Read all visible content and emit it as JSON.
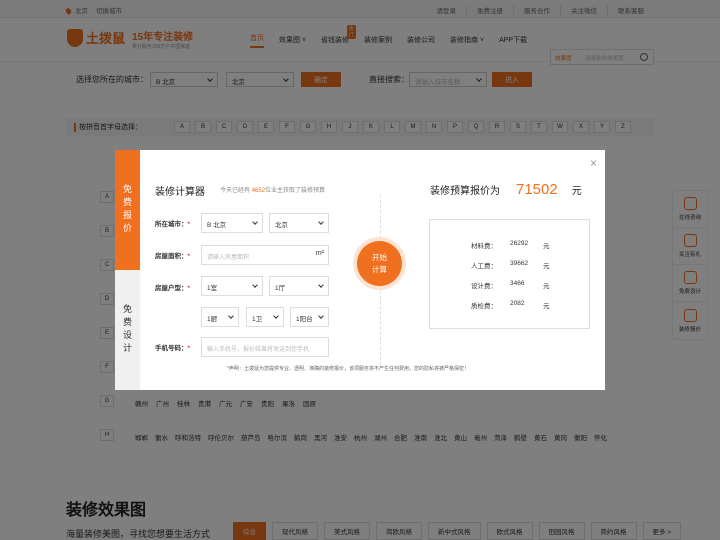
{
  "topbar": {
    "city": "北京",
    "switch_city": "切换城市",
    "links": [
      "请登录",
      "免费注册",
      "服务合作",
      "关注微信",
      "联系客服"
    ]
  },
  "header": {
    "logo_text": "土拨鼠",
    "slogan_big": "15年专注装修",
    "slogan_small": "累计服务100万户中国家庭",
    "nav": [
      {
        "label": "首页",
        "active": true
      },
      {
        "label": "效果图",
        "caret": true
      },
      {
        "label": "省钱装修",
        "badge": "热门"
      },
      {
        "label": "装修案例"
      },
      {
        "label": "装修公司"
      },
      {
        "label": "装修指南",
        "caret": true
      },
      {
        "label": "APP下载"
      }
    ],
    "search_category": "效果图",
    "search_placeholder": "海量装修效果图"
  },
  "city_select": {
    "label": "选择您所在的城市：",
    "province": "B 北京",
    "city": "北京",
    "confirm": "确定",
    "search_label": "直接搜索：",
    "search_placeholder": "请输入城市名称",
    "enter": "进入"
  },
  "pinyin": {
    "label": "按拼音首字母选择：",
    "letters": [
      "A",
      "B",
      "C",
      "D",
      "E",
      "F",
      "G",
      "H",
      "J",
      "K",
      "L",
      "M",
      "N",
      "P",
      "Q",
      "R",
      "S",
      "T",
      "W",
      "X",
      "Y",
      "Z"
    ]
  },
  "city_rows": [
    {
      "letter": "A",
      "cities": []
    },
    {
      "letter": "B",
      "cities": []
    },
    {
      "letter": "C",
      "cities": []
    },
    {
      "letter": "D",
      "cities": []
    },
    {
      "letter": "E",
      "cities": []
    },
    {
      "letter": "F",
      "cities": []
    },
    {
      "letter": "G",
      "cities": [
        "赣州",
        "广州",
        "桂林",
        "贵港",
        "广元",
        "广安",
        "贵阳",
        "果洛",
        "固原"
      ]
    },
    {
      "letter": "H",
      "cities": [
        "邯郸",
        "衡水",
        "呼和浩特",
        "呼伦贝尔",
        "葫芦岛",
        "哈尔滨",
        "鹤岗",
        "黑河",
        "淮安",
        "杭州",
        "湖州",
        "合肥",
        "淮南",
        "淮北",
        "黄山",
        "亳州",
        "菏泽",
        "鹤壁",
        "黄石",
        "黄冈",
        "衡阳",
        "怀化"
      ]
    }
  ],
  "sidebar": [
    "在线咨询",
    "关注有礼",
    "免费设计",
    "装修报价"
  ],
  "section": {
    "title": "装修效果图",
    "subtitle": "海量装修美图，寻找您想要生活方式",
    "styles": [
      "综合",
      "现代风格",
      "美式风格",
      "简欧风格",
      "新中式风格",
      "欧式风格",
      "田园风格",
      "简约风格",
      "更多 >"
    ]
  },
  "modal": {
    "tab1": "免费报价",
    "tab2": "免费设计",
    "close": "×",
    "title": "装修计算器",
    "sub_prefix": "今天已经有",
    "sub_count": "4652",
    "sub_suffix": "位业主获取了装修预算",
    "city_label": "所在城市：",
    "city_province": "B 北京",
    "city_city": "北京",
    "area_label": "房屋面积：",
    "area_placeholder": "请输入房屋面积",
    "area_unit": "m²",
    "type_label": "房屋户型：",
    "room": "1室",
    "hall": "1厅",
    "kitchen": "1厨",
    "bath": "1卫",
    "balcony": "1阳台",
    "phone_label": "手机号码：",
    "phone_placeholder": "输入手机号，报价结果将发送到您手机",
    "required": "*",
    "calc_button_l1": "开始",
    "calc_button_l2": "计算",
    "result_label": "装修预算报价为",
    "result_total": "71502",
    "result_unit": "元",
    "breakdown": [
      {
        "name": "材料费：",
        "value": "26292",
        "unit": "元"
      },
      {
        "name": "人工费：",
        "value": "39662",
        "unit": "元"
      },
      {
        "name": "设计费：",
        "value": "3466",
        "unit": "元"
      },
      {
        "name": "质检费：",
        "value": "2082",
        "unit": "元"
      }
    ],
    "note": "*声明：土拨鼠为您提供专业、透明、准确的装修报价，该项服务将不产生任何费用，您的隐私将被严格保密！"
  }
}
